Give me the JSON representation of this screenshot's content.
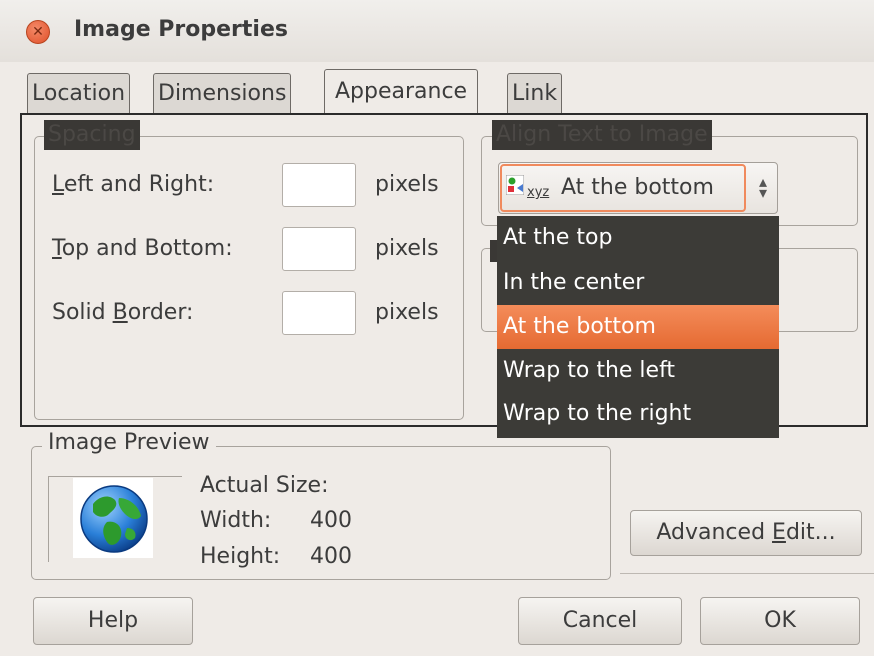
{
  "window": {
    "title": "Image Properties"
  },
  "tabs": [
    "Location",
    "Dimensions",
    "Appearance",
    "Link"
  ],
  "spacing": {
    "legend": "Spacing",
    "rows": [
      {
        "label_ul": "L",
        "label_rest": "eft and Right:",
        "unit": "pixels",
        "value": ""
      },
      {
        "label_ul": "T",
        "label_rest": "op and Bottom:",
        "unit": "pixels",
        "value": ""
      },
      {
        "label_pre": "Solid ",
        "label_ul": "B",
        "label_rest": "order:",
        "unit": "pixels",
        "value": ""
      }
    ]
  },
  "align": {
    "legend": "Align Text to Image",
    "icon_text": "xyz",
    "selected": "At the bottom",
    "options": [
      "At the top",
      "In the center",
      "At the bottom",
      "Wrap to the left",
      "Wrap to the right"
    ],
    "selected_index": 2
  },
  "preview": {
    "legend": "Image Preview",
    "actual_size": "Actual Size:",
    "width_label": "Width:",
    "width_value": "400",
    "height_label": "Height:",
    "height_value": "400"
  },
  "buttons": {
    "advanced_pre": "Advanced ",
    "advanced_ul": "E",
    "advanced_rest": "dit...",
    "help": "Help",
    "cancel": "Cancel",
    "ok": "OK"
  },
  "colors": {
    "accent": "#e9703a",
    "menu_bg": "#3c3b37"
  }
}
